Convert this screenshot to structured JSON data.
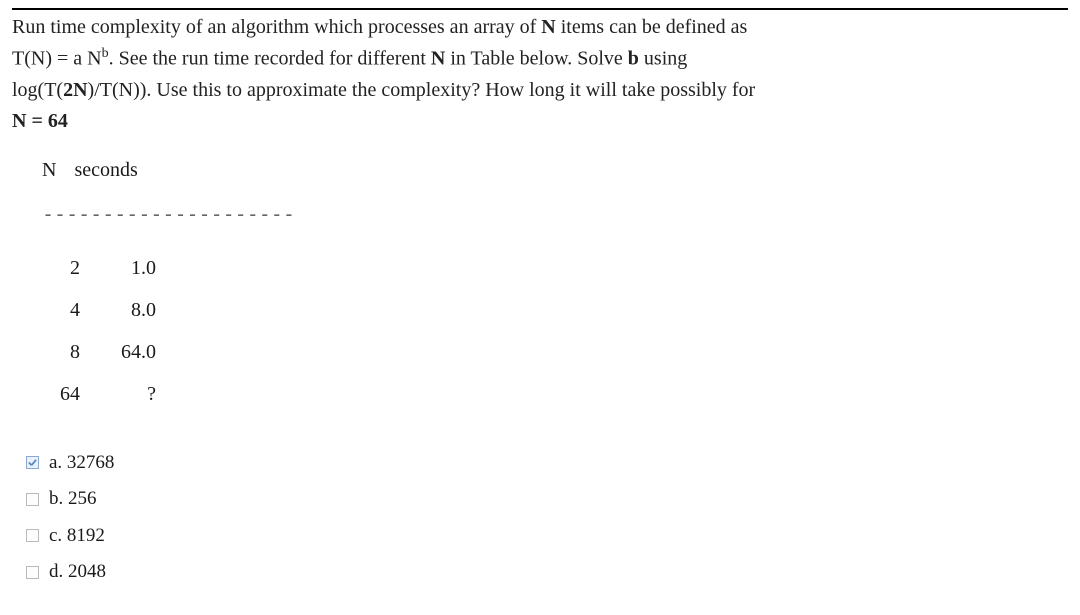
{
  "question": {
    "line1_pre": "Run time complexity of an algorithm which processes an array of ",
    "line1_bold": "N",
    "line1_post": " items can be defined as",
    "line2_eq_lhs": "T(N) = a N",
    "line2_eq_sup": "b",
    "line2_post1": ". See the run time recorded for different ",
    "line2_bold1": "N",
    "line2_post2": " in Table below.  Solve ",
    "line2_bold2": "b",
    "line2_post3": " using",
    "line3_pre": "log(T(",
    "line3_bold1": "2N",
    "line3_mid": ")/T(N)).  Use this to approximate the complexity? How long it will take possibly for",
    "line4_pre": "N = 64"
  },
  "table": {
    "header_n": "N",
    "header_s": "seconds",
    "sep": "---------------------",
    "rows": [
      {
        "n": "2",
        "s": "1.0"
      },
      {
        "n": "4",
        "s": "8.0"
      },
      {
        "n": "8",
        "s": "64.0"
      },
      {
        "n": "64",
        "s": "?"
      }
    ]
  },
  "options": [
    {
      "label": "a. 32768",
      "checked": true
    },
    {
      "label": "b. 256",
      "checked": false
    },
    {
      "label": "c. 8192",
      "checked": false
    },
    {
      "label": "d. 2048",
      "checked": false
    }
  ]
}
